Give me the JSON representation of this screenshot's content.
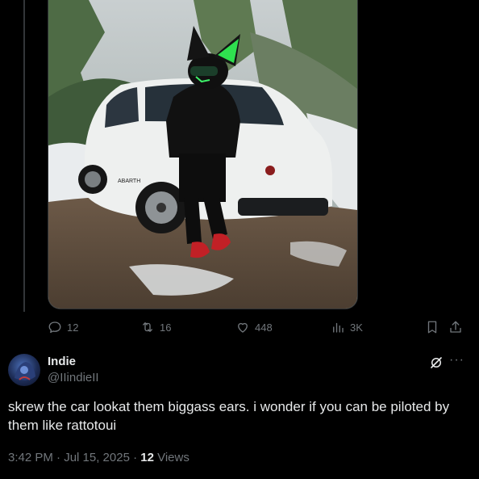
{
  "post_media": {
    "alt": "Person in a black jacket and fursuit head with green ears leaning on a white Fiat Abarth in the snow",
    "car_badge": "ABARTH"
  },
  "actions": {
    "replies": "12",
    "reposts": "16",
    "likes": "448",
    "views": "3K"
  },
  "reply": {
    "name": "Indie",
    "handle": "@IIindieII",
    "text": "skrew the car lookat them biggass ears. i wonder if you can be piloted by them like rattotoui",
    "time": "3:42 PM · Jul 15, 2025 · ",
    "view_count": "12",
    "views_label": " Views",
    "more": "···"
  }
}
